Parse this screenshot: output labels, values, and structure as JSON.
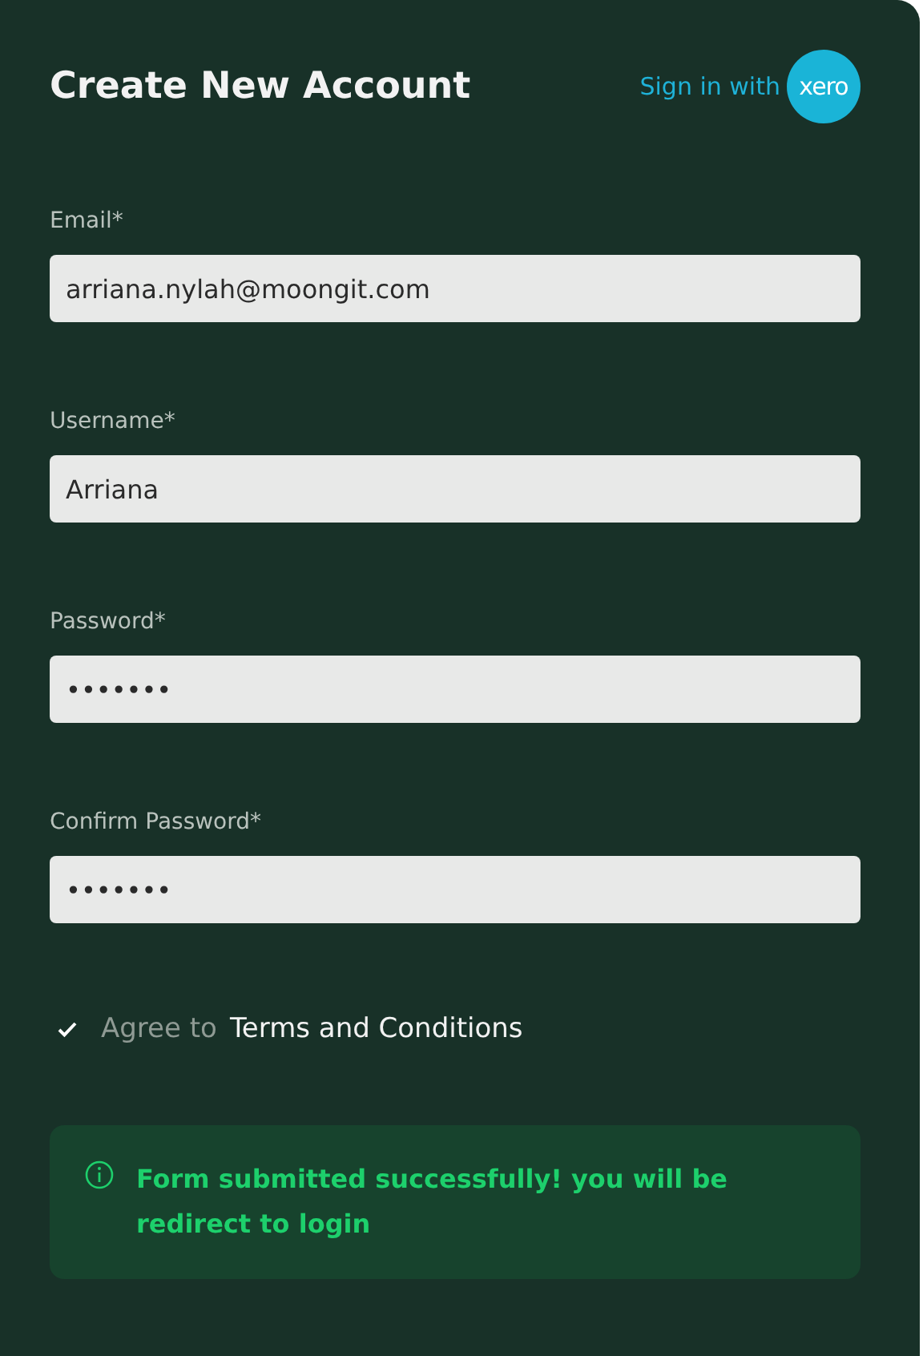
{
  "header": {
    "title": "Create New Account",
    "sign_in": {
      "label": "Sign in with",
      "logo_text": "xero"
    }
  },
  "fields": [
    {
      "label": "Email*",
      "value": "arriana.nylah@moongit.com"
    },
    {
      "label": "Username*",
      "value": "Arriana"
    },
    {
      "label": "Password*",
      "value": "•••••••"
    },
    {
      "label": "Confirm Password*",
      "value": "•••••••"
    }
  ],
  "agree": {
    "checked": true,
    "label": "Agree to",
    "link": "Terms and Conditions"
  },
  "alert": {
    "kind": "success",
    "message": "Form submitted successfully! you will be redirect to login"
  }
}
